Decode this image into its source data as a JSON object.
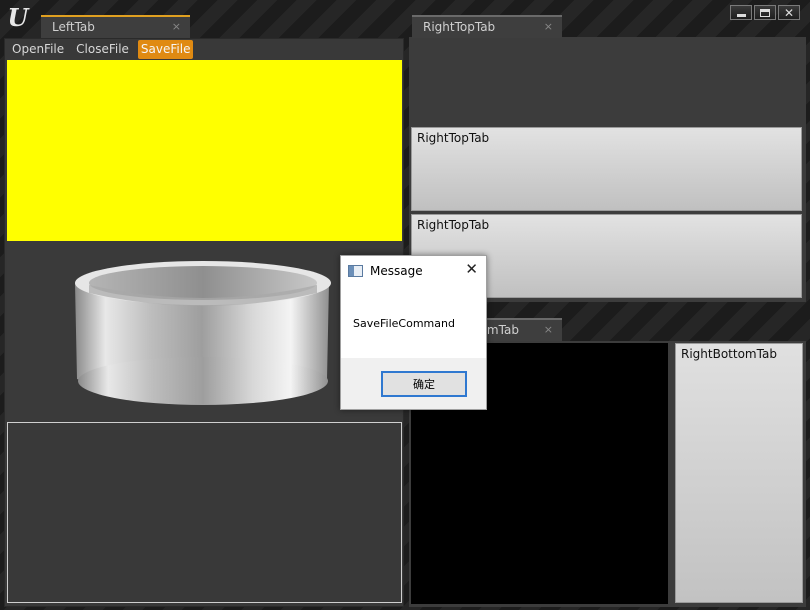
{
  "window": {
    "logo_text": "U",
    "controls": [
      "minimize",
      "maximize",
      "close"
    ],
    "close_glyph": "✕"
  },
  "tabs": {
    "left": {
      "label": "LeftTab",
      "close": "×"
    },
    "right_top": {
      "label": "RightTopTab",
      "close": "×"
    },
    "right_bottom": {
      "label": "RightBottomTab",
      "close": "×"
    }
  },
  "menu": [
    {
      "label": "OpenFile",
      "active": false
    },
    {
      "label": "CloseFile",
      "active": false
    },
    {
      "label": "SaveFile",
      "active": true
    }
  ],
  "right_top_panel": {
    "box1_label": "RightTopTab",
    "box2_label": "RightTopTab"
  },
  "right_bottom_panel": {
    "box_label": "RightBottomTab"
  },
  "dialog": {
    "title": "Message",
    "close": "✕",
    "message": "SaveFileCommand",
    "ok_label": "确定"
  },
  "colors": {
    "yellow_area": "#ffff00",
    "active_tab_accent": "#e0a020",
    "active_menu": "#e08a12",
    "button_focus": "#2f78d0"
  },
  "icons": {
    "logo": "unreal-logo-icon",
    "dialog": "window-icon",
    "viewport_object": "ring-mesh"
  }
}
